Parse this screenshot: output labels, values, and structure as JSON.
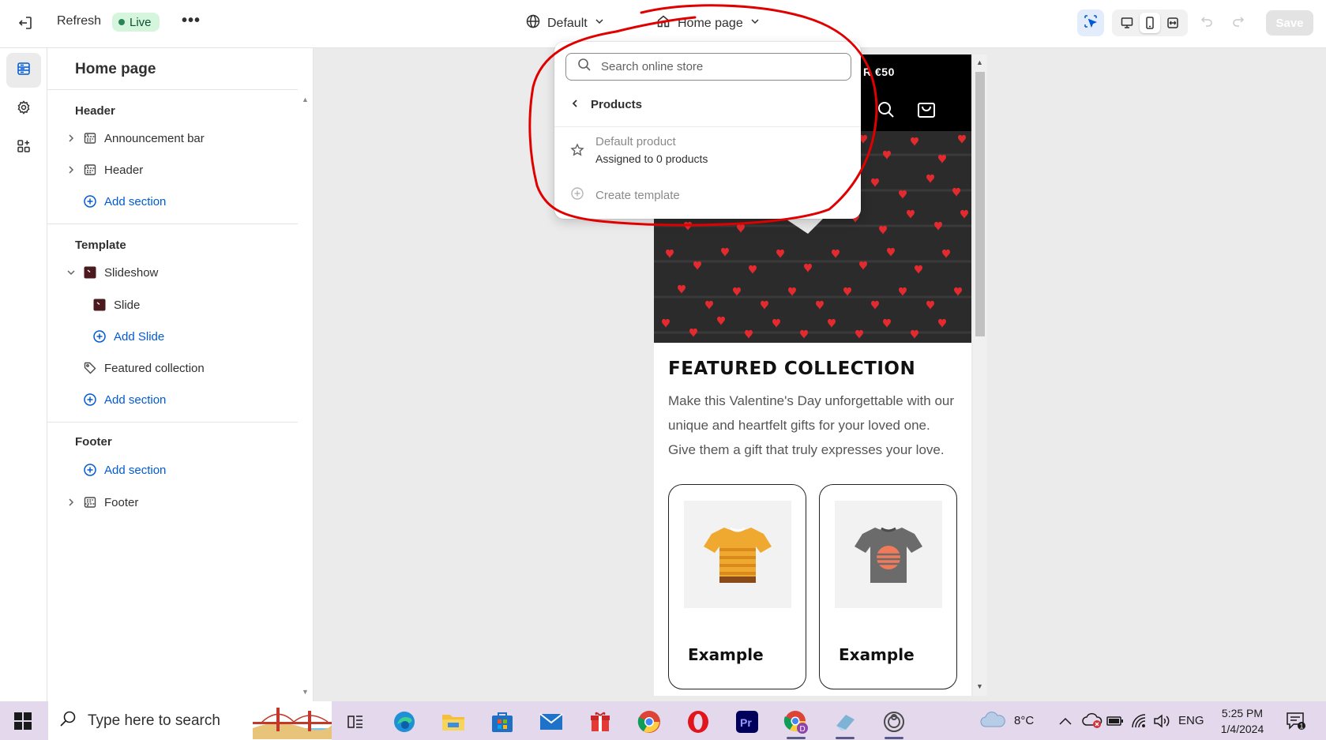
{
  "topbar": {
    "refresh_label": "Refresh",
    "live_label": "Live",
    "more_label": "•••",
    "theme_label": "Default",
    "page_label": "Home page",
    "save_label": "Save"
  },
  "sidebar": {
    "title": "Home page",
    "header_group": "Header",
    "announcement_bar": "Announcement bar",
    "header_item": "Header",
    "add_section_1": "Add section",
    "template_group": "Template",
    "slideshow": "Slideshow",
    "slide": "Slide",
    "add_slide": "Add Slide",
    "featured_collection": "Featured collection",
    "add_section_2": "Add section",
    "footer_group": "Footer",
    "add_section_3": "Add section",
    "footer_item": "Footer"
  },
  "dropdown": {
    "search_placeholder": "Search online store",
    "back_label": "Products",
    "item_name": "Default product",
    "item_sub": "Assigned to 0 products",
    "create_label": "Create template"
  },
  "preview": {
    "announcement_text": "R €50",
    "heading": "FEATURED COLLECTION",
    "description": "Make this Valentine's Day unforgettable with our unique and heartfelt gifts for your loved one. Give them a gift that truly expresses your love.",
    "card1_title": "Example",
    "card2_title": "Example"
  },
  "taskbar": {
    "search_placeholder": "Type here to search",
    "weather": "8°C",
    "language": "ENG",
    "time": "5:25 PM",
    "date": "1/4/2024",
    "notifications_count": "1"
  },
  "colors": {
    "accent": "#005bd3",
    "annotation": "#e00000",
    "live_bg": "#d5f5dd",
    "taskbar": "#e4d9ec"
  }
}
